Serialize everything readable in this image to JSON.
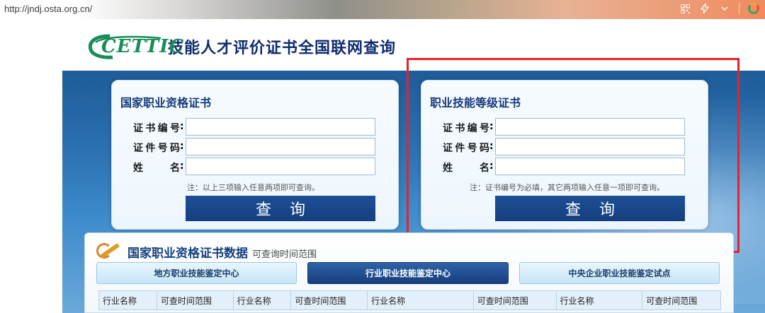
{
  "browser": {
    "url": "http://jndj.osta.org.cn/"
  },
  "header": {
    "logo_text": "CETTIC",
    "title": "技能人才评价证书全国联网查询"
  },
  "panel_left": {
    "title": "国家职业资格证书",
    "fields": [
      {
        "label": "证书编号",
        "value": "",
        "placeholder": ""
      },
      {
        "label": "证件号码",
        "value": "",
        "placeholder": ""
      },
      {
        "label": "姓名",
        "value": "",
        "placeholder": ""
      }
    ],
    "note": "注：以上三项输入任意两项即可查询。",
    "button_label": "查询"
  },
  "panel_right": {
    "title": "职业技能等级证书",
    "fields": [
      {
        "label": "证书编号",
        "value": "",
        "placeholder": ""
      },
      {
        "label": "证件号码",
        "value": "",
        "placeholder": ""
      },
      {
        "label": "姓名",
        "value": "",
        "placeholder": ""
      }
    ],
    "note": "注：证书编号为必填，其它两项输入任意一项即可查询。",
    "button_label": "查询"
  },
  "data_section": {
    "title": "国家职业资格证书数据",
    "subtitle": "可查询时间范围",
    "tabs": [
      {
        "label": "地方职业技能鉴定中心",
        "active": false
      },
      {
        "label": "行业职业技能鉴定中心",
        "active": true
      },
      {
        "label": "中央企业职业技能鉴定试点",
        "active": false
      }
    ],
    "columns": [
      "行业名称",
      "可查时间范围",
      "行业名称",
      "可查时间范围",
      "行业名称",
      "可查时间范围",
      "行业名称",
      "可查时间范围"
    ]
  },
  "colors": {
    "brand_blue": "#163f7e",
    "logo_green": "#1a8c58",
    "highlight_red": "#e8222a"
  }
}
